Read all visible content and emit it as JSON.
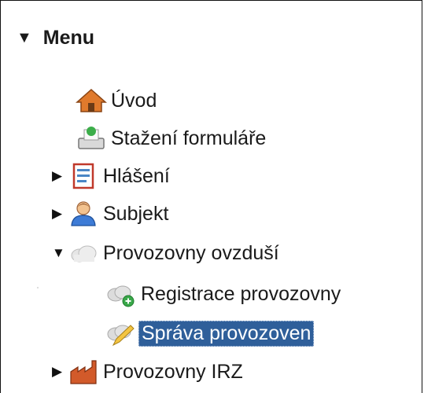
{
  "menu": {
    "title": "Menu",
    "items": [
      {
        "label": "Úvod",
        "icon": "home-icon",
        "toggle": ""
      },
      {
        "label": "Stažení formuláře",
        "icon": "download-icon",
        "toggle": ""
      },
      {
        "label": "Hlášení",
        "icon": "report-icon",
        "toggle": "▶"
      },
      {
        "label": "Subjekt",
        "icon": "user-icon",
        "toggle": "▶"
      },
      {
        "label": "Provozovny ovzduší",
        "icon": "cloud-icon",
        "toggle": "▼"
      },
      {
        "label": "Registrace provozovny",
        "icon": "cloud-add-icon",
        "toggle": ""
      },
      {
        "label": "Správa provozoven",
        "icon": "cloud-edit-icon",
        "toggle": "",
        "selected": true
      },
      {
        "label": "Provozovny IRZ",
        "icon": "factory-icon",
        "toggle": "▶"
      }
    ]
  },
  "colors": {
    "selected_bg": "#2f5f9a",
    "selected_text": "#ffffff"
  }
}
